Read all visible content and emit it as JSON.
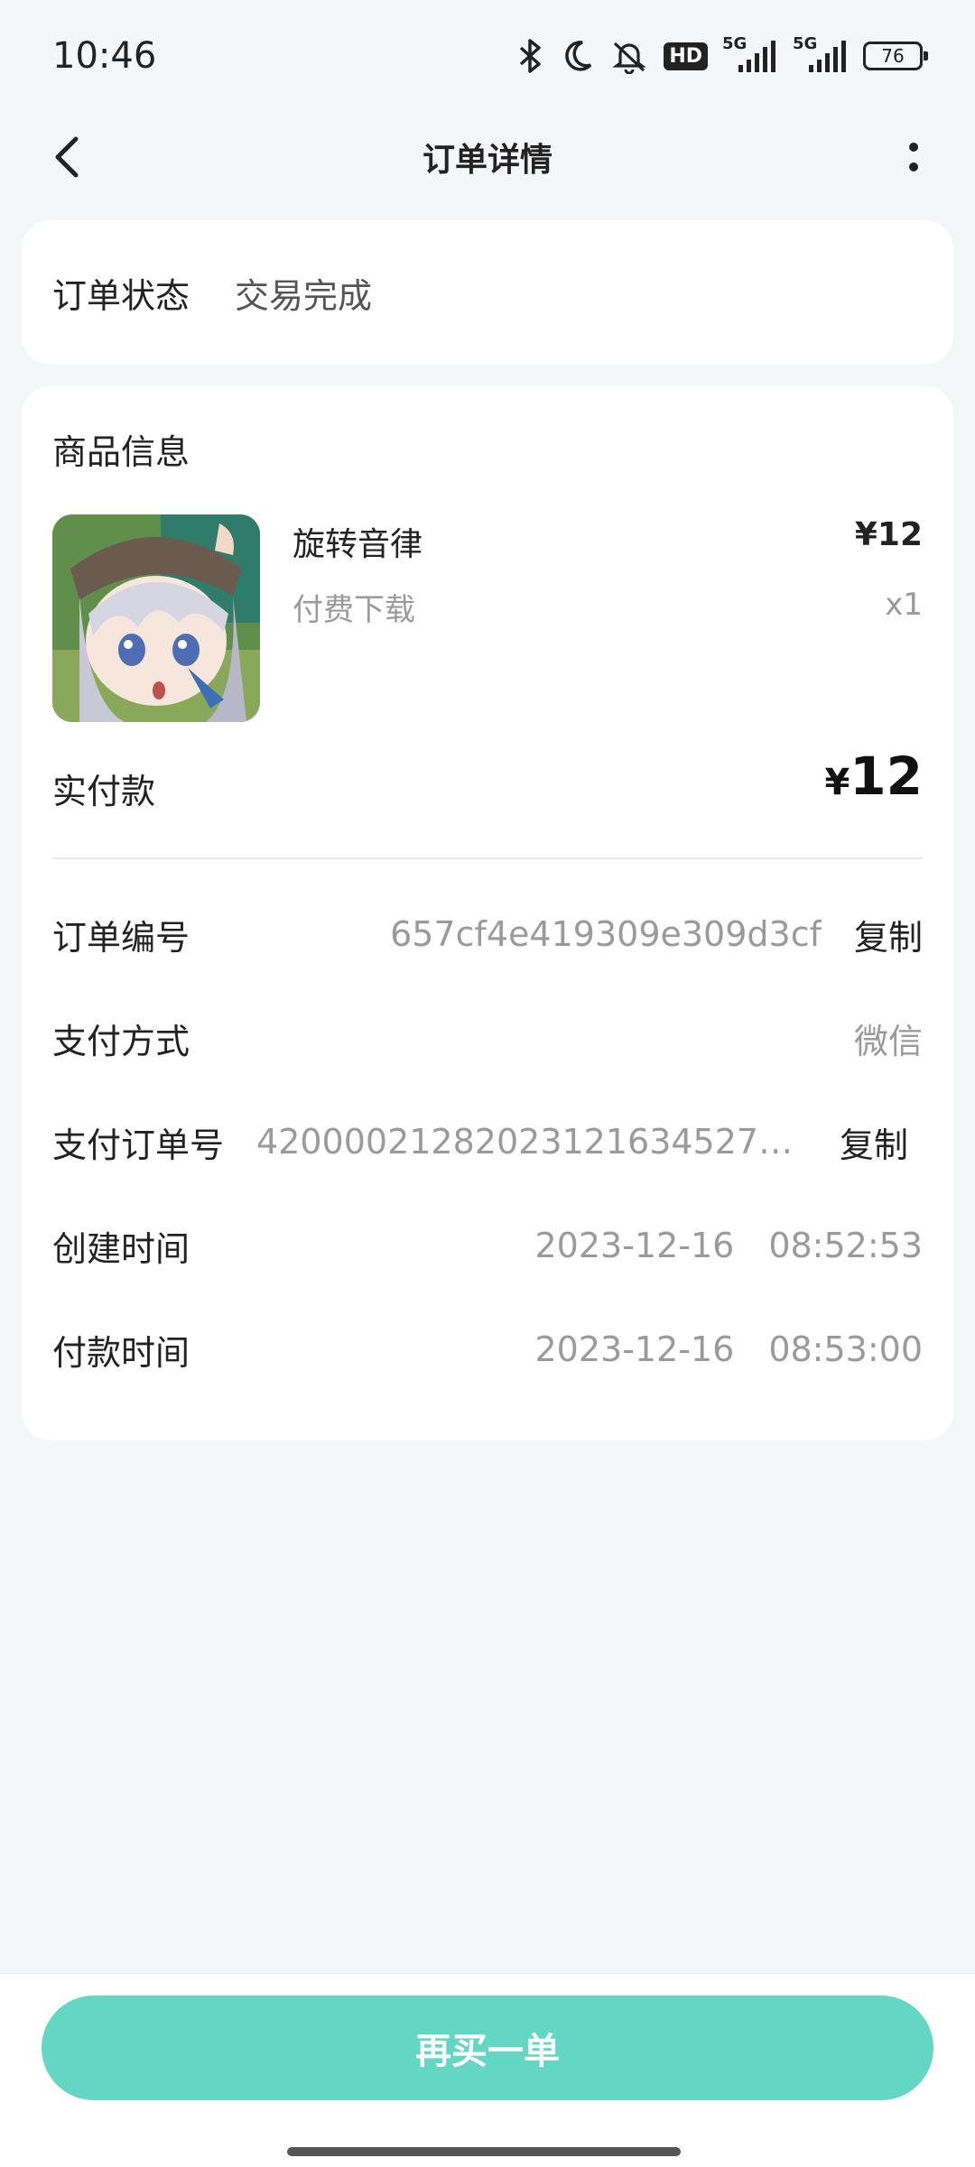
{
  "status_bar": {
    "time": "10:46",
    "hd_label": "HD",
    "net1_label": "5G",
    "net2_label": "5G",
    "battery": "76",
    "icons": [
      "bluetooth-icon",
      "moon-icon",
      "mute-bell-icon",
      "hd-badge",
      "signal-icon",
      "signal-icon",
      "battery-icon"
    ]
  },
  "nav": {
    "title": "订单详情",
    "back_icon": "chevron-left-icon",
    "more_icon": "more-vertical-icon"
  },
  "order_status": {
    "label": "订单状态",
    "value": "交易完成"
  },
  "product_section": {
    "title": "商品信息",
    "name": "旋转音律",
    "type": "付费下载",
    "price": "¥12",
    "quantity": "x1",
    "thumbnail": "game-thumbnail-anime-girl"
  },
  "payment": {
    "label": "实付款",
    "currency": "¥",
    "amount": "12"
  },
  "details": {
    "order_no_label": "订单编号",
    "order_no": "657cf4e419309e309d3cf",
    "pay_method_label": "支付方式",
    "pay_method": "微信",
    "pay_order_no_label": "支付订单号",
    "pay_order_no": "4200002128202312163452768...",
    "created_label": "创建时间",
    "created_date": "2023-12-16",
    "created_time": "08:52:53",
    "paid_label": "付款时间",
    "paid_date": "2023-12-16",
    "paid_time": "08:53:00",
    "copy_label": "复制"
  },
  "actions": {
    "rebuy": "再买一单"
  },
  "colors": {
    "accent": "#63d6c4",
    "background": "#f5f6f8"
  }
}
